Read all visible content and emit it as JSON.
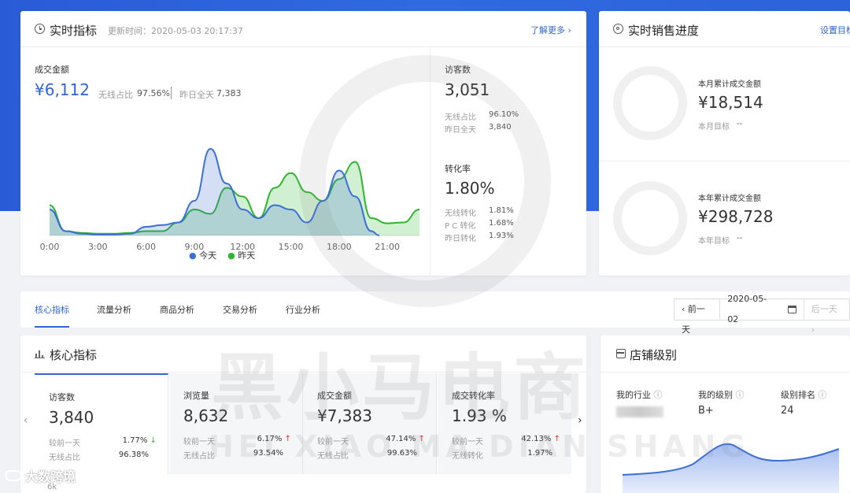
{
  "realtime": {
    "title": "实时指标",
    "update_time": "更新时间：2020-05-03 20:17:37",
    "more_link": "了解更多 ›",
    "gmv_label": "成交金额",
    "gmv_value": "¥6,112",
    "wireless_label": "无线占比",
    "wireless_value": "97.56%",
    "yesterday_label": "昨日全天",
    "yesterday_value": "7,383",
    "legend_today": "今天",
    "legend_yesterday": "昨天",
    "visitors_label": "访客数",
    "visitors_value": "3,051",
    "visitors_wireless_label": "无线占比",
    "visitors_wireless_value": "96.10%",
    "visitors_yesterday_label": "昨日全天",
    "visitors_yesterday_value": "3,840",
    "conversion_label": "转化率",
    "conversion_value": "1.80%",
    "conv_wireless_label": "无线转化",
    "conv_wireless_value": "1.81%",
    "conv_pc_label": "P C 转化",
    "conv_pc_value": "1.68%",
    "conv_yesterday_label": "昨日转化",
    "conv_yesterday_value": "1.93%"
  },
  "chart_data": {
    "type": "line",
    "categories": [
      "0:00",
      "3:00",
      "6:00",
      "9:00",
      "12:00",
      "15:00",
      "18:00",
      "21:00"
    ],
    "x_range": [
      0,
      23
    ],
    "series": [
      {
        "name": "今天",
        "color": "#3b6fd8",
        "points": [
          [
            0,
            0.3
          ],
          [
            1,
            0.05
          ],
          [
            2,
            0.02
          ],
          [
            3,
            0.01
          ],
          [
            4,
            0.01
          ],
          [
            5,
            0.02
          ],
          [
            6,
            0.1
          ],
          [
            7,
            0.12
          ],
          [
            8,
            0.15
          ],
          [
            9,
            0.4
          ],
          [
            10,
            1.0
          ],
          [
            11,
            0.6
          ],
          [
            12,
            0.3
          ],
          [
            13,
            0.2
          ],
          [
            14,
            0.35
          ],
          [
            15,
            0.3
          ],
          [
            16,
            0.15
          ],
          [
            17,
            0.4
          ],
          [
            18,
            0.75
          ],
          [
            19,
            0.45
          ],
          [
            20,
            0.05
          ],
          [
            20.5,
            0
          ]
        ]
      },
      {
        "name": "昨天",
        "color": "#2fb52f",
        "points": [
          [
            0,
            0.35
          ],
          [
            1,
            0.05
          ],
          [
            2,
            0.03
          ],
          [
            3,
            0.02
          ],
          [
            4,
            0.02
          ],
          [
            5,
            0.03
          ],
          [
            6,
            0.05
          ],
          [
            7,
            0.05
          ],
          [
            8,
            0.15
          ],
          [
            9,
            0.3
          ],
          [
            10,
            0.25
          ],
          [
            11,
            0.55
          ],
          [
            12,
            0.45
          ],
          [
            13,
            0.2
          ],
          [
            14,
            0.55
          ],
          [
            15,
            0.72
          ],
          [
            16,
            0.5
          ],
          [
            17,
            0.4
          ],
          [
            18,
            0.65
          ],
          [
            19,
            0.85
          ],
          [
            20,
            0.2
          ],
          [
            21,
            0.14
          ],
          [
            22,
            0.15
          ],
          [
            23,
            0.3
          ]
        ]
      }
    ]
  },
  "sales_progress": {
    "title": "实时销售进度",
    "set_goal": "设置目标",
    "month_label": "本月累计成交金额",
    "month_value": "¥18,514",
    "month_goal_label": "本月目标",
    "month_goal_value": "--",
    "year_label": "本年累计成交金额",
    "year_value": "¥298,728",
    "year_goal_label": "本年目标",
    "year_goal_value": "--"
  },
  "tabs": [
    "核心指标",
    "流量分析",
    "商品分析",
    "交易分析",
    "行业分析"
  ],
  "date_nav": {
    "prev": "‹ 前一天",
    "date": "2020-05-02",
    "next": "后一天 ›"
  },
  "core": {
    "title": "核心指标",
    "metrics": [
      {
        "label": "访客数",
        "value": "3,840",
        "cmp_label": "较前一天",
        "cmp_value": "1.77%",
        "cmp_dir": "↓",
        "share_label": "无线占比",
        "share_value": "96.38%"
      },
      {
        "label": "浏览量",
        "value": "8,632",
        "cmp_label": "较前一天",
        "cmp_value": "6.17%",
        "cmp_dir": "↑",
        "share_label": "无线占比",
        "share_value": "93.54%"
      },
      {
        "label": "成交金额",
        "value": "¥7,383",
        "cmp_label": "较前一天",
        "cmp_value": "47.14%",
        "cmp_dir": "↑",
        "share_label": "无线占比",
        "share_value": "99.63%"
      },
      {
        "label": "成交转化率",
        "value": "1.93 %",
        "cmp_label": "较前一天",
        "cmp_value": "42.13%",
        "cmp_dir": "↑",
        "share_label": "无线转化",
        "share_value": "1.97%"
      }
    ],
    "axis_label": "6k"
  },
  "shop_level": {
    "title": "店铺级别",
    "industry_label": "我的行业",
    "level_label": "我的级别",
    "level_value": "B+",
    "rank_label": "级别排名",
    "rank_value": "24"
  },
  "watermark": {
    "text": "黑小马电商",
    "latin": "HEI XIAO MA DIAN SHANG",
    "corner": "大数跨境"
  }
}
